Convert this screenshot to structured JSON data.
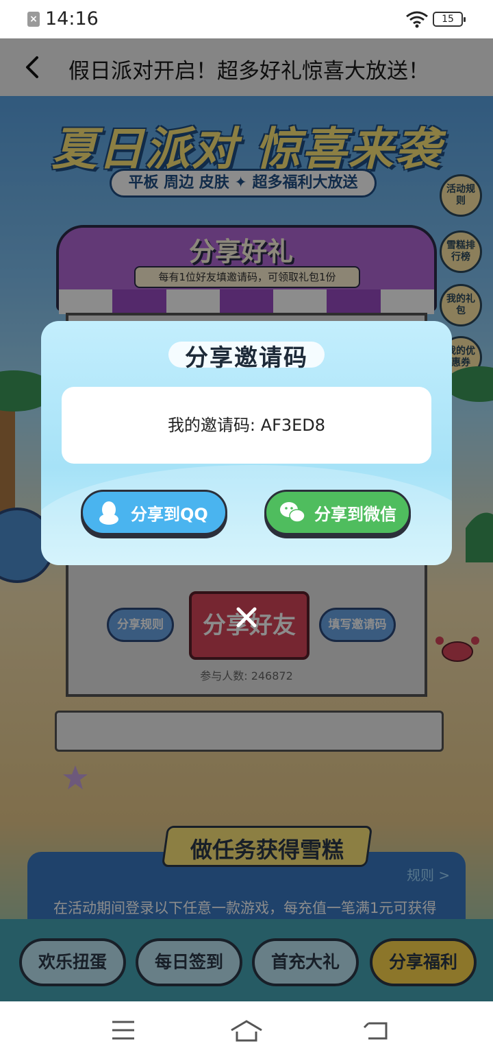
{
  "status_bar": {
    "time": "14:16",
    "battery": "15"
  },
  "header": {
    "title": "假日派对开启！超多好礼惊喜大放送！"
  },
  "banner": {
    "title": "夏日派对 惊喜来袭",
    "subtitle": "平板 周边 皮肤 ✦ 超多福利大放送"
  },
  "side_menu": [
    "活动规则",
    "雪糕排行榜",
    "我的礼包",
    "我的优惠券"
  ],
  "shop": {
    "sign": "分享好礼",
    "note": "每有1位好友填邀请码，可领取礼包1份",
    "share_rules": "分享规则",
    "share_friends": "分享好友",
    "enter_code": "填写邀请码",
    "participants": "参与人数: 246872"
  },
  "task": {
    "title": "做任务获得雪糕",
    "rules_link": "规则 >",
    "desc": "在活动期间登录以下任意一款游戏，每充值一笔满1元可获得"
  },
  "tabs": [
    "欢乐扭蛋",
    "每日签到",
    "首充大礼",
    "分享福利"
  ],
  "dialog": {
    "title": "分享邀请码",
    "code_text": "我的邀请码: AF3ED8",
    "share_qq": "分享到QQ",
    "share_wechat": "分享到微信"
  },
  "colors": {
    "qq": "#4ab4ef",
    "wechat": "#4fbd5e",
    "awning": "#b268d8"
  }
}
